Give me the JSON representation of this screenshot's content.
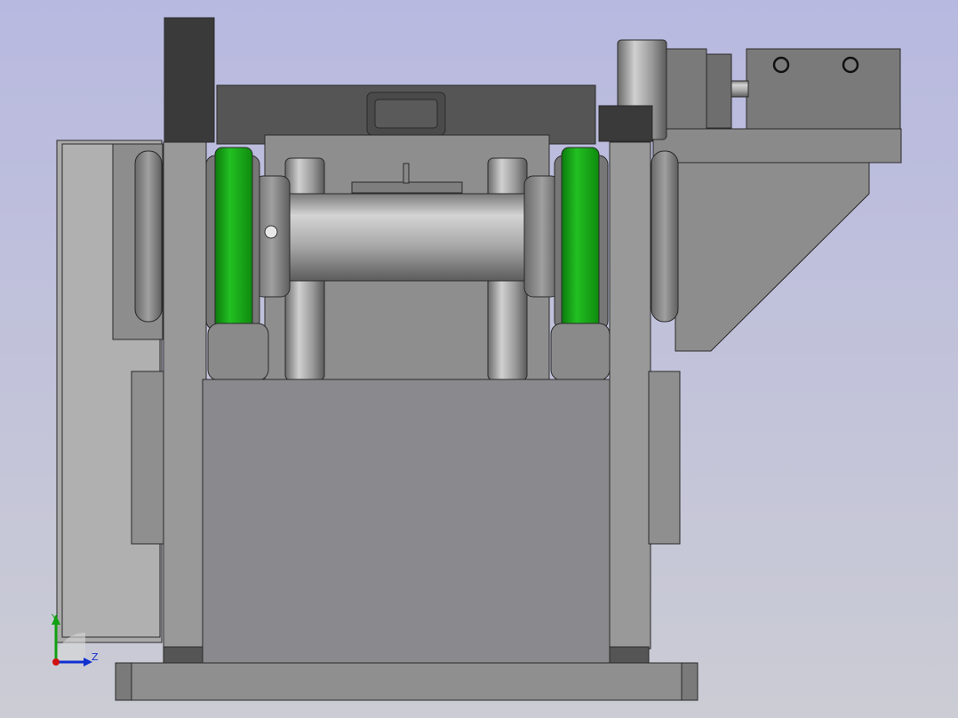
{
  "viewport": {
    "background_top": "#b9badf",
    "background_bottom": "#c9cad3"
  },
  "colors": {
    "body_light": "#a6a6a6",
    "body_mid": "#8c8c90",
    "body_dark": "#505050",
    "block_dark": "#3a3a3a",
    "edge": "#2a2a2a",
    "wheel_green": "#1faf1f",
    "wheel_green_dark": "#0f7f0f",
    "triad_x": "#d01010",
    "triad_y": "#10a010",
    "triad_z": "#1030d0"
  },
  "icons": {
    "triad": "coordinate-triad-icon"
  },
  "triad": {
    "y_label": "Y",
    "z_label": "Z"
  }
}
